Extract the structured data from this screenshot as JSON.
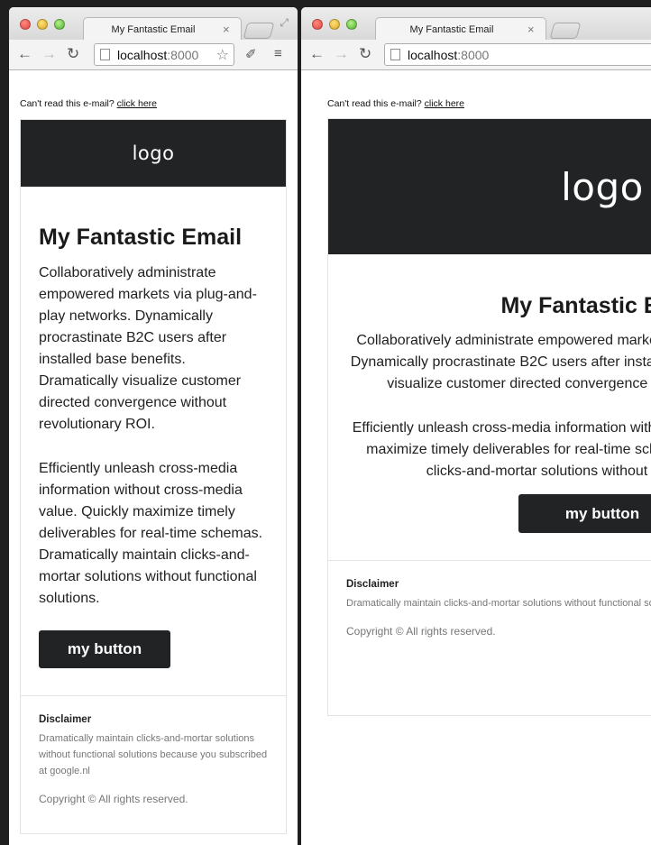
{
  "browser": {
    "tab_title": "My Fantastic Email",
    "tab_close": "×",
    "url_host": "localhost",
    "url_port": ":8000"
  },
  "email": {
    "preheader_text": "Can't read this e-mail?",
    "preheader_link": "click here",
    "logo": "logo",
    "title": "My Fantastic Email",
    "paragraph1": "Collaboratively administrate empowered markets via plug-and-play networks. Dynamically procrastinate B2C users after installed base benefits. Dramatically visualize customer directed convergence without revolutionary ROI.",
    "paragraph2": "Efficiently unleash cross-media information without cross-media value. Quickly maximize timely deliverables for real-time schemas. Dramatically maintain clicks-and-mortar solutions without functional solutions.",
    "button": "my button",
    "disclaimer_heading": "Disclaimer",
    "disclaimer_text": "Dramatically maintain clicks-and-mortar solutions without functional solutions because you subscribed at google.nl",
    "copyright": "Copyright © All rights reserved."
  },
  "colors": {
    "dark_bar": "#222325",
    "page_bg": "#1f1f1f"
  },
  "icons": [
    "back-icon",
    "forward-icon",
    "reload-icon",
    "page-icon",
    "bookmark-star-icon",
    "extension-icon",
    "menu-icon",
    "fullscreen-icon"
  ]
}
